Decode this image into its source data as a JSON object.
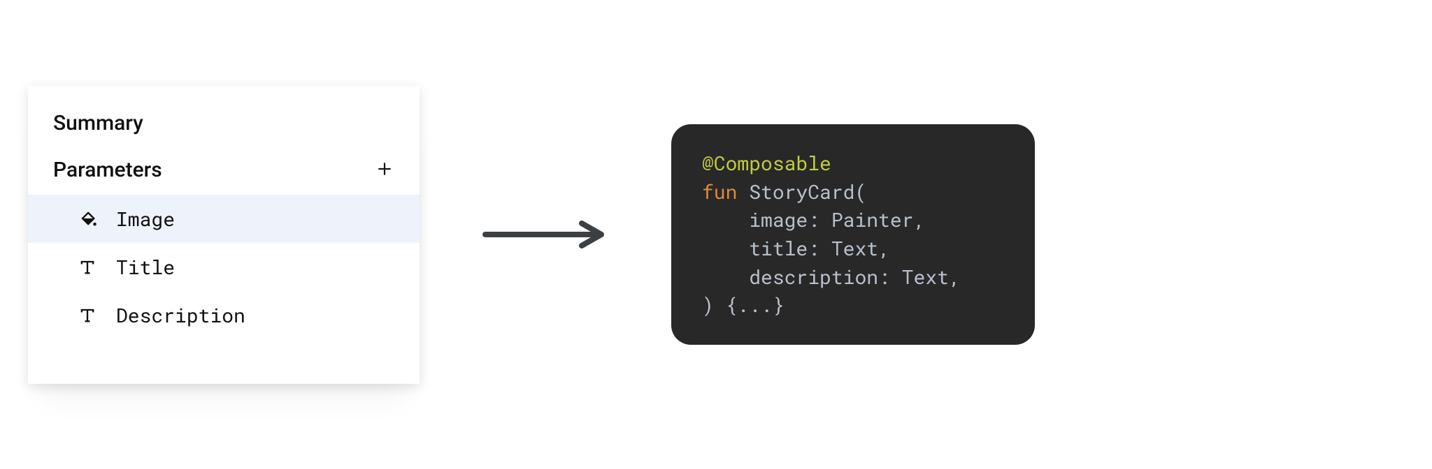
{
  "panel": {
    "summary_label": "Summary",
    "parameters_label": "Parameters",
    "items": [
      {
        "icon": "fill",
        "label": "Image",
        "selected": true
      },
      {
        "icon": "text",
        "label": "Title",
        "selected": false
      },
      {
        "icon": "text",
        "label": "Description",
        "selected": false
      }
    ]
  },
  "code": {
    "annotation": "@Composable",
    "keyword_fun": "fun",
    "func_name": "StoryCard",
    "params": [
      {
        "name": "image",
        "type": "Painter"
      },
      {
        "name": "title",
        "type": "Text"
      },
      {
        "name": "description",
        "type": "Text"
      }
    ],
    "body_placeholder": "{...}"
  }
}
